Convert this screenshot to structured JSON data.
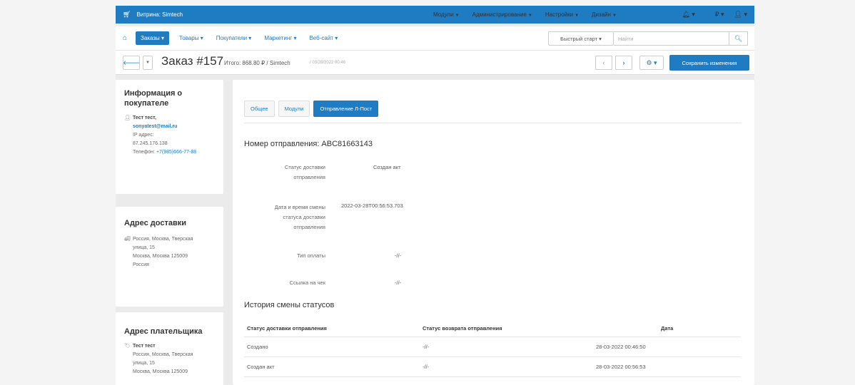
{
  "topbar": {
    "store_label": "Витрина: Simtech",
    "nav": [
      "Модули",
      "Администрирование",
      "Настройки",
      "Дизайн"
    ],
    "currency": "₽"
  },
  "secnav": {
    "menu": [
      "Заказы",
      "Товары",
      "Покупатели",
      "Маркетинг",
      "Веб-сайт"
    ],
    "quick_start": "Быстрый старт",
    "search_placeholder": "Найти"
  },
  "titlebar": {
    "title": "Заказ #157",
    "total": "Итого: 868.80 ₽ / Simtech",
    "date": "/ 03/28/2022 00:46",
    "save_label": "Сохранить изменения"
  },
  "customer": {
    "heading": "Информация о покупателе",
    "name": "Тест тест,",
    "email": "sonyatest@mail.ru",
    "ip_label": "IP адрес:",
    "ip": "87.245.176.138",
    "phone_label": "Телефон:",
    "phone": "+7(985)666-77-88"
  },
  "shipping": {
    "heading": "Адрес доставки",
    "line1": "Россия, Москва, Тверская",
    "line2": "улица, 15",
    "line3": "Москва, Москва 125009",
    "line4": "Россия"
  },
  "billing": {
    "heading": "Адрес плательщика",
    "name": "Тест тест",
    "line1": "Россия, Москва, Тверская",
    "line2": "улица, 15",
    "line3": "Москва, Москва 125009"
  },
  "tabs": [
    "Общее",
    "Модули",
    "Отправление Л-Пост"
  ],
  "shipment": {
    "number_heading": "Номер отправления: ABC81663143",
    "status_label_1": "Статус доставки",
    "status_label_2": "отправления",
    "status_value": "Создан акт",
    "datetime_label_1": "Дата и время смены",
    "datetime_label_2": "статуса доставки",
    "datetime_label_3": "отправления",
    "datetime_value": "2022-03-28T00:56:53.703",
    "payment_label": "Тип оплаты",
    "payment_value": "-//-",
    "receipt_label": "Ссылка на чек",
    "receipt_value": "-//-"
  },
  "history": {
    "heading": "История смены статусов",
    "columns": [
      "Статус доставки отправления",
      "Статус возврата отправления",
      "Дата"
    ],
    "rows": [
      [
        "Создано",
        "-//-",
        "28-03-2022 00:46:50"
      ],
      [
        "Создан акт",
        "-//-",
        "28-03-2022 00:56:53"
      ]
    ]
  }
}
